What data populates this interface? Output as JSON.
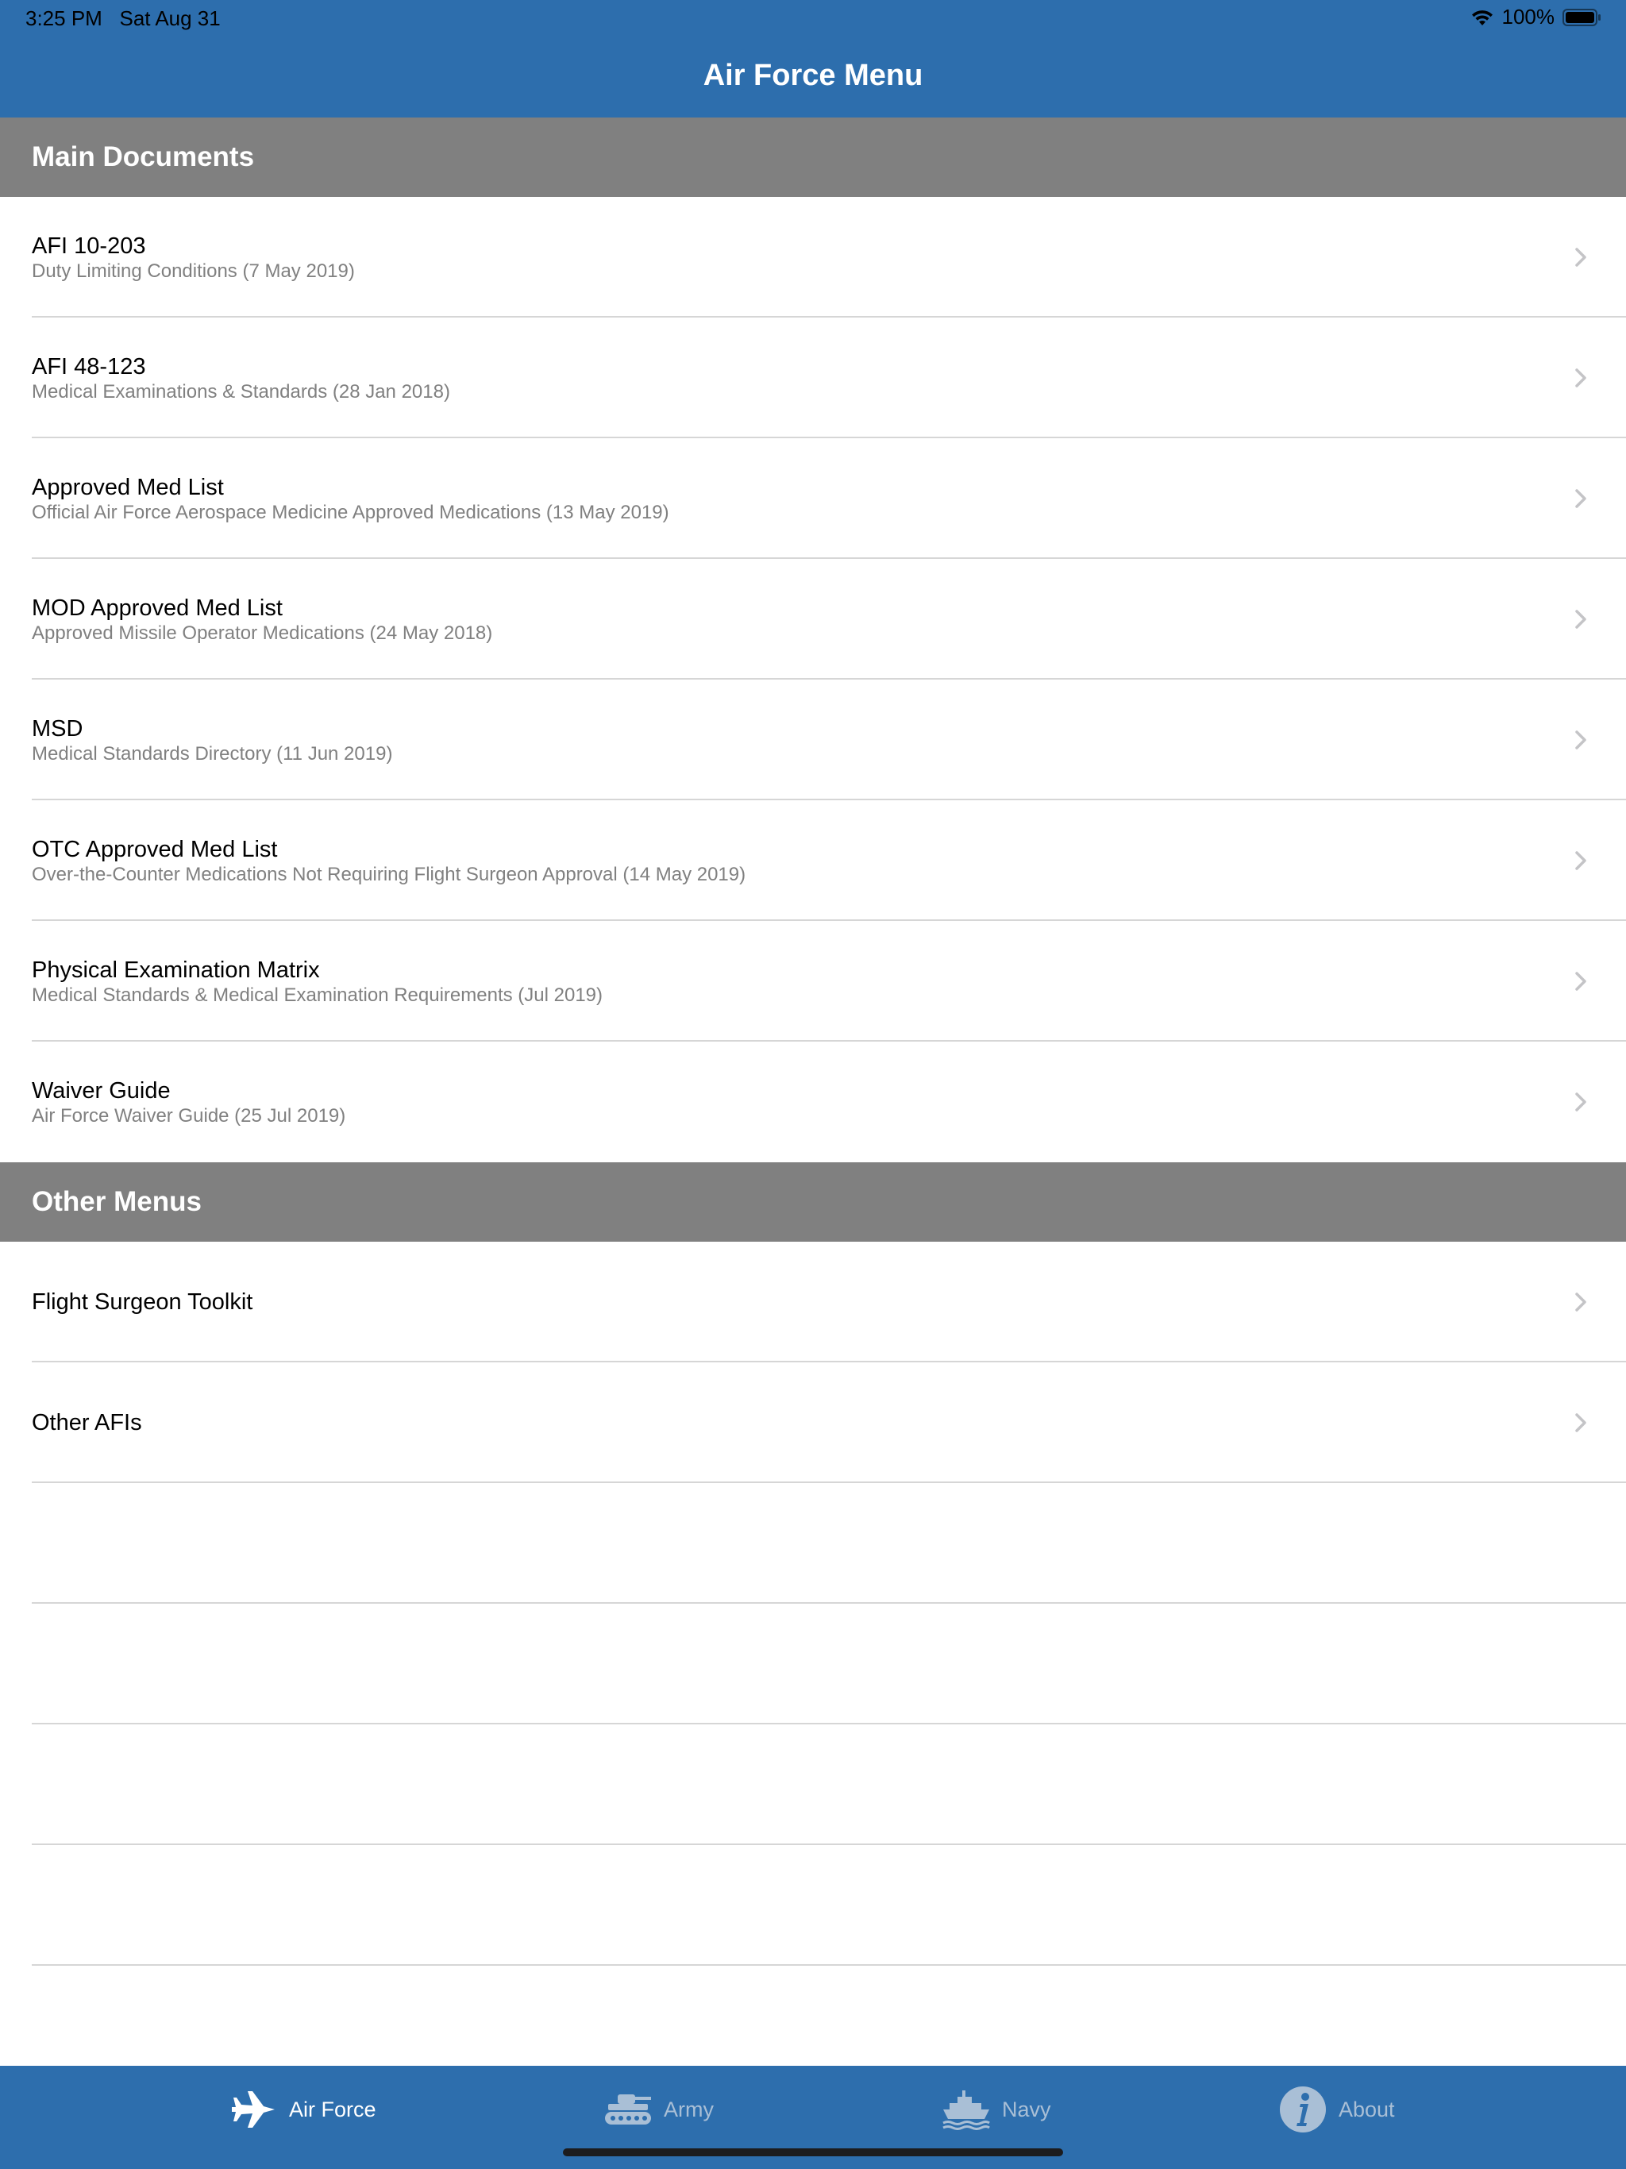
{
  "status_bar": {
    "time": "3:25 PM",
    "date": "Sat Aug 31",
    "battery": "100%"
  },
  "nav": {
    "title": "Air Force Menu"
  },
  "sections": {
    "main": {
      "header": "Main Documents",
      "items": [
        {
          "title": "AFI 10-203",
          "subtitle": "Duty Limiting Conditions (7 May 2019)"
        },
        {
          "title": "AFI 48-123",
          "subtitle": "Medical Examinations & Standards (28 Jan 2018)"
        },
        {
          "title": "Approved Med List",
          "subtitle": "Official Air Force Aerospace Medicine Approved Medications (13 May 2019)"
        },
        {
          "title": "MOD Approved Med List",
          "subtitle": "Approved Missile Operator Medications (24 May 2018)"
        },
        {
          "title": "MSD",
          "subtitle": "Medical Standards Directory (11 Jun 2019)"
        },
        {
          "title": "OTC Approved Med List",
          "subtitle": "Over-the-Counter Medications Not Requiring Flight Surgeon Approval (14 May 2019)"
        },
        {
          "title": "Physical Examination Matrix",
          "subtitle": "Medical Standards & Medical Examination Requirements (Jul 2019)"
        },
        {
          "title": "Waiver Guide",
          "subtitle": "Air Force Waiver Guide (25 Jul 2019)"
        }
      ]
    },
    "other": {
      "header": "Other Menus",
      "items": [
        {
          "title": "Flight Surgeon Toolkit"
        },
        {
          "title": "Other AFIs"
        }
      ]
    }
  },
  "tab_bar": {
    "tabs": [
      {
        "label": "Air Force",
        "icon": "jet-icon",
        "active": true
      },
      {
        "label": "Army",
        "icon": "tank-icon",
        "active": false
      },
      {
        "label": "Navy",
        "icon": "ship-icon",
        "active": false
      },
      {
        "label": "About",
        "icon": "info-icon",
        "active": false
      }
    ]
  },
  "colors": {
    "brand_blue": "#2d6ead",
    "section_gray": "#808080",
    "subtitle_gray": "#808080",
    "tab_inactive": "#a9bfd6"
  }
}
